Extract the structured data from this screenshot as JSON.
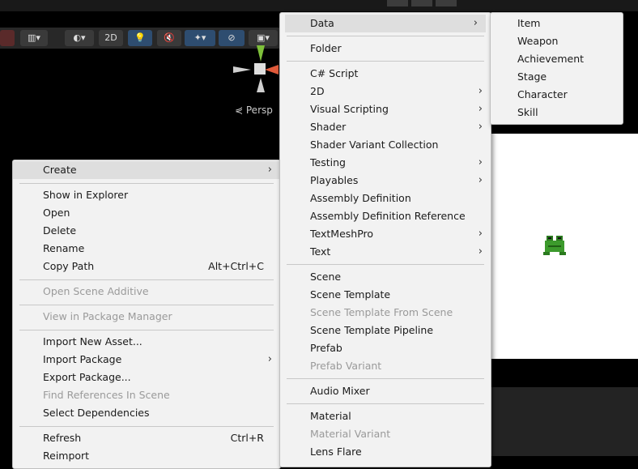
{
  "context_menu": {
    "items": [
      {
        "label": "Create",
        "arrow": true,
        "highlighted": true
      },
      {
        "label": "Show in Explorer"
      },
      {
        "label": "Open"
      },
      {
        "label": "Delete"
      },
      {
        "label": "Rename"
      },
      {
        "label": "Copy Path",
        "shortcut": "Alt+Ctrl+C"
      },
      {
        "label": "Open Scene Additive",
        "disabled": true
      },
      {
        "label": "View in Package Manager",
        "disabled": true
      },
      {
        "label": "Import New Asset..."
      },
      {
        "label": "Import Package",
        "arrow": true
      },
      {
        "label": "Export Package..."
      },
      {
        "label": "Find References In Scene",
        "disabled": true
      },
      {
        "label": "Select Dependencies"
      },
      {
        "label": "Refresh",
        "shortcut": "Ctrl+R"
      },
      {
        "label": "Reimport"
      }
    ]
  },
  "create_menu": {
    "items": [
      {
        "label": "Data",
        "arrow": true,
        "highlighted": true
      },
      {
        "label": "Folder"
      },
      {
        "label": "C# Script"
      },
      {
        "label": "2D",
        "arrow": true
      },
      {
        "label": "Visual Scripting",
        "arrow": true
      },
      {
        "label": "Shader",
        "arrow": true
      },
      {
        "label": "Shader Variant Collection"
      },
      {
        "label": "Testing",
        "arrow": true
      },
      {
        "label": "Playables",
        "arrow": true
      },
      {
        "label": "Assembly Definition"
      },
      {
        "label": "Assembly Definition Reference"
      },
      {
        "label": "TextMeshPro",
        "arrow": true
      },
      {
        "label": "Text",
        "arrow": true
      },
      {
        "label": "Scene"
      },
      {
        "label": "Scene Template"
      },
      {
        "label": "Scene Template From Scene",
        "disabled": true
      },
      {
        "label": "Scene Template Pipeline"
      },
      {
        "label": "Prefab"
      },
      {
        "label": "Prefab Variant",
        "disabled": true
      },
      {
        "label": "Audio Mixer"
      },
      {
        "label": "Material"
      },
      {
        "label": "Material Variant",
        "disabled": true
      },
      {
        "label": "Lens Flare"
      }
    ]
  },
  "data_submenu": {
    "items": [
      {
        "label": "Item"
      },
      {
        "label": "Weapon"
      },
      {
        "label": "Achievement"
      },
      {
        "label": "Stage"
      },
      {
        "label": "Character"
      },
      {
        "label": "Skill"
      }
    ]
  },
  "toolbar": {
    "mode_2d": "2D"
  },
  "scene": {
    "persp_label": "Persp"
  },
  "colors": {
    "gizmo_y": "#7ec03a",
    "gizmo_x": "#e05a3a",
    "frog": "#3c9a2c"
  }
}
